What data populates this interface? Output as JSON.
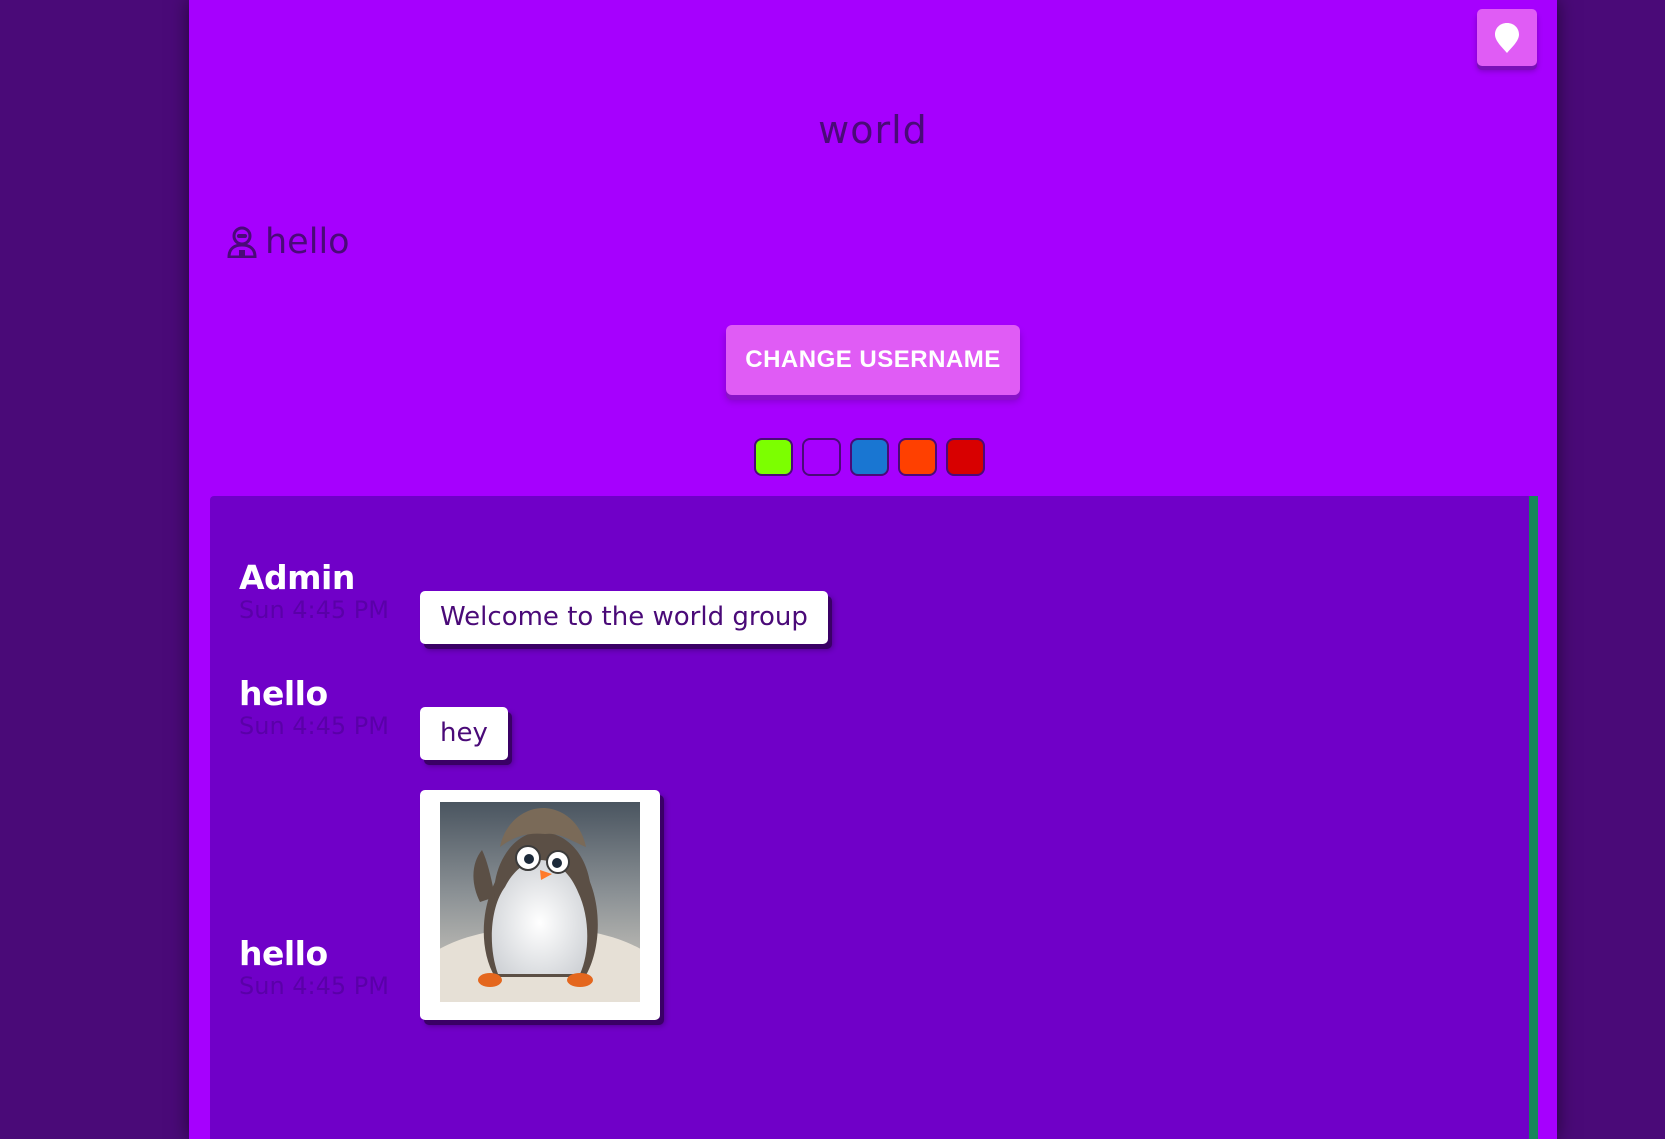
{
  "header": {
    "room_title": "world",
    "username": "hello",
    "change_username_label": "CHANGE USERNAME",
    "theme_icon": "map-pin-icon",
    "user_icon": "user-icon"
  },
  "theme_colors": [
    "#7cff00",
    "#a600fe",
    "#1976d2",
    "#ff4000",
    "#d80000"
  ],
  "messages": [
    {
      "author": "Admin",
      "time": "Sun 4:45 PM",
      "text": "Welcome to the world group"
    },
    {
      "author": "hello",
      "time": "Sun 4:45 PM",
      "text": "hey"
    },
    {
      "author": "hello",
      "time": "Sun 4:45 PM",
      "image": "penguin-image"
    }
  ],
  "colors": {
    "background": "#4a0a78",
    "panel": "#a600fe",
    "chat": "#7000c8",
    "accent": "#e05cf5"
  }
}
